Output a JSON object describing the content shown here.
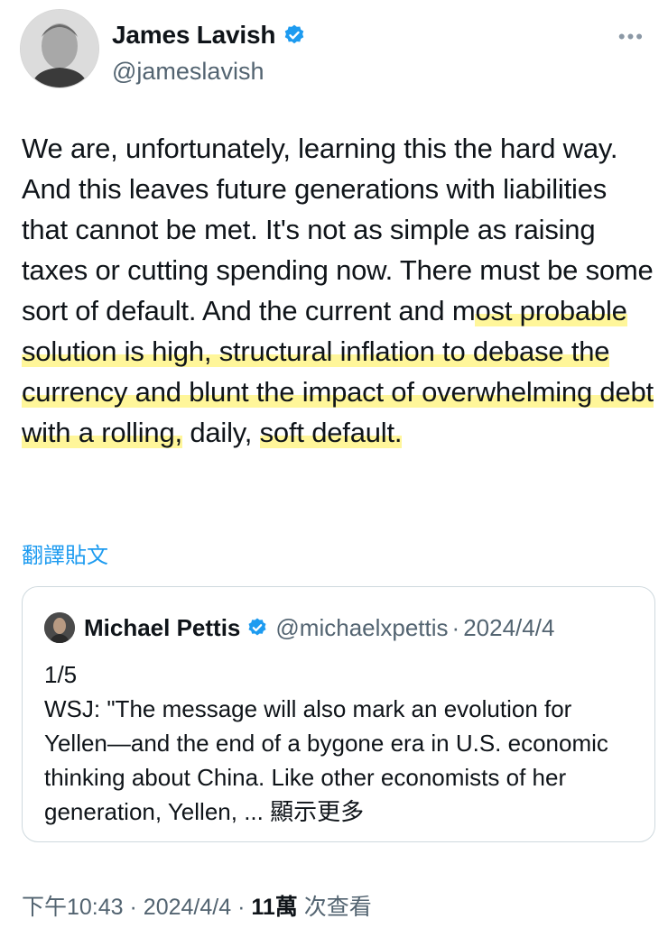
{
  "author": {
    "name": "James Lavish",
    "handle": "@jameslavish",
    "verified_icon": "verified-badge-icon",
    "more_icon": "more-dots-icon"
  },
  "tweet": {
    "text_parts": [
      "We are, unfortunately, learning this the hard way. And this leaves future generations with liabilities that cannot be met. It's not as simple as raising taxes or cutting spending now. There must be some sort of default. And the current and m",
      "ost probable solution is high, structural inflation to debase the currency and blunt the impact of overwhelming debt with a rolling,",
      " daily, ",
      "soft default."
    ],
    "translate_label": "翻譯貼文"
  },
  "quote": {
    "name": "Michael Pettis",
    "handle": "@michaelxpettis",
    "separator": "·",
    "date": "2024/4/4",
    "line1": "1/5",
    "text": "WSJ: \"The message will also mark an evolution for Yellen—and the end of a bygone era in U.S. economic thinking about China. Like other economists of her generation, Yellen, ...",
    "show_more": "顯示更多"
  },
  "meta": {
    "time": "下午10:43",
    "sep1": "·",
    "date": "2024/4/4",
    "sep2": "·",
    "views_count": "11萬",
    "views_label": "次查看"
  },
  "colors": {
    "accent": "#1d9bf0",
    "highlight": "#fff378",
    "secondary_text": "#536471"
  }
}
